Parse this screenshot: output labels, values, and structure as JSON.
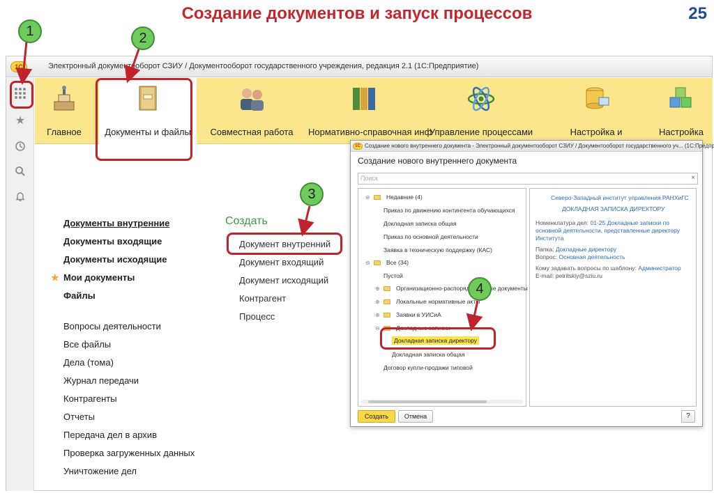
{
  "slide": {
    "title": "Создание документов и запуск процессов",
    "page_number": "25"
  },
  "window": {
    "title": "Электронный документооборот СЗИУ / Документооборот государственного учреждения, редакция 2.1  (1С:Предприятие)",
    "logo_text": "1С"
  },
  "sidebar": {
    "icons": [
      "apps-grid-icon",
      "star-icon",
      "history-icon",
      "search-icon",
      "bell-icon"
    ]
  },
  "sections": [
    {
      "label": "Главное",
      "icon": "podium-icon"
    },
    {
      "label": "Документы и файлы",
      "icon": "book-icon"
    },
    {
      "label": "Совместная работа",
      "icon": "people-icon"
    },
    {
      "label": "Нормативно-справочная инф",
      "icon": "binders-icon"
    },
    {
      "label": "Управление процессами",
      "icon": "atom-icon"
    },
    {
      "label": "Настройка и",
      "icon": "database-icon"
    },
    {
      "label": "Настройка",
      "icon": "cubes-icon"
    }
  ],
  "nav": {
    "primary": [
      "Документы внутренние",
      "Документы входящие",
      "Документы исходящие",
      "Мои документы",
      "Файлы"
    ],
    "secondary": [
      "Вопросы деятельности",
      "Все файлы",
      "Дела (тома)",
      "Журнал передачи",
      "Контрагенты",
      "Отчеты",
      "Передача дел в архив",
      "Проверка загруженных данных",
      "Уничтожение дел"
    ]
  },
  "create": {
    "heading": "Создать",
    "items": [
      "Документ внутренний",
      "Документ входящий",
      "Документ исходящий",
      "Контрагент",
      "Процесс"
    ]
  },
  "dialog": {
    "title": "Создание нового внутреннего документа - Электронный документооборот СЗИУ / Документооборот государственного уч...  (1С:Предприятие)",
    "heading": "Создание нового внутреннего документа",
    "search_placeholder": "Поиск",
    "search_clear": "×",
    "tree": {
      "recent_group": "Недавние (4)",
      "recent_items": [
        "Приказ по движению контингента обучающихся",
        "Докладная записка общая",
        "Приказ по основной деятельности",
        "Заявка в техническую поддержку (КАС)"
      ],
      "all_group": "Все (34)",
      "empty_item": "Пустой",
      "folders": [
        "Организационно-распорядительные документы",
        "Локальные нормативные акты",
        "Заявки в УИСиА",
        "Докладные записки"
      ],
      "selected": "Докладная записка директору",
      "sub_item": "Докладная записка общая",
      "last_item": "Договор купли-продажи типовой"
    },
    "preview": {
      "org": "Северо-Западный институт управления РАНХиГС",
      "doc_title": "ДОКЛАДНАЯ ЗАПИСКА ДИРЕКТОРУ",
      "nomen_label": "Номенклатура дел:",
      "nomen_value_1": "01-25 Докладные записки по",
      "nomen_value_2": "основной деятельности, представленные директору",
      "nomen_value_3": "Института",
      "folder_label": "Папка:",
      "folder_value": "Докладные директору",
      "question_label": "Вопрос:",
      "question_value": "Основная деятельность",
      "ask_label": "Кому задавать вопросы по шаблону:",
      "ask_value": "Администратор",
      "email": "E-mail: petritskiy@sziu.ru"
    },
    "buttons": {
      "create": "Создать",
      "cancel": "Отмена",
      "help": "?"
    }
  },
  "callouts": [
    "1",
    "2",
    "3",
    "4"
  ],
  "colors": {
    "accent_red": "#c0232b",
    "badge_green": "#6fcb5c",
    "section_bar": "#fbe68c",
    "link_blue": "#2e6bb5",
    "create_green": "#3c9a4a"
  }
}
